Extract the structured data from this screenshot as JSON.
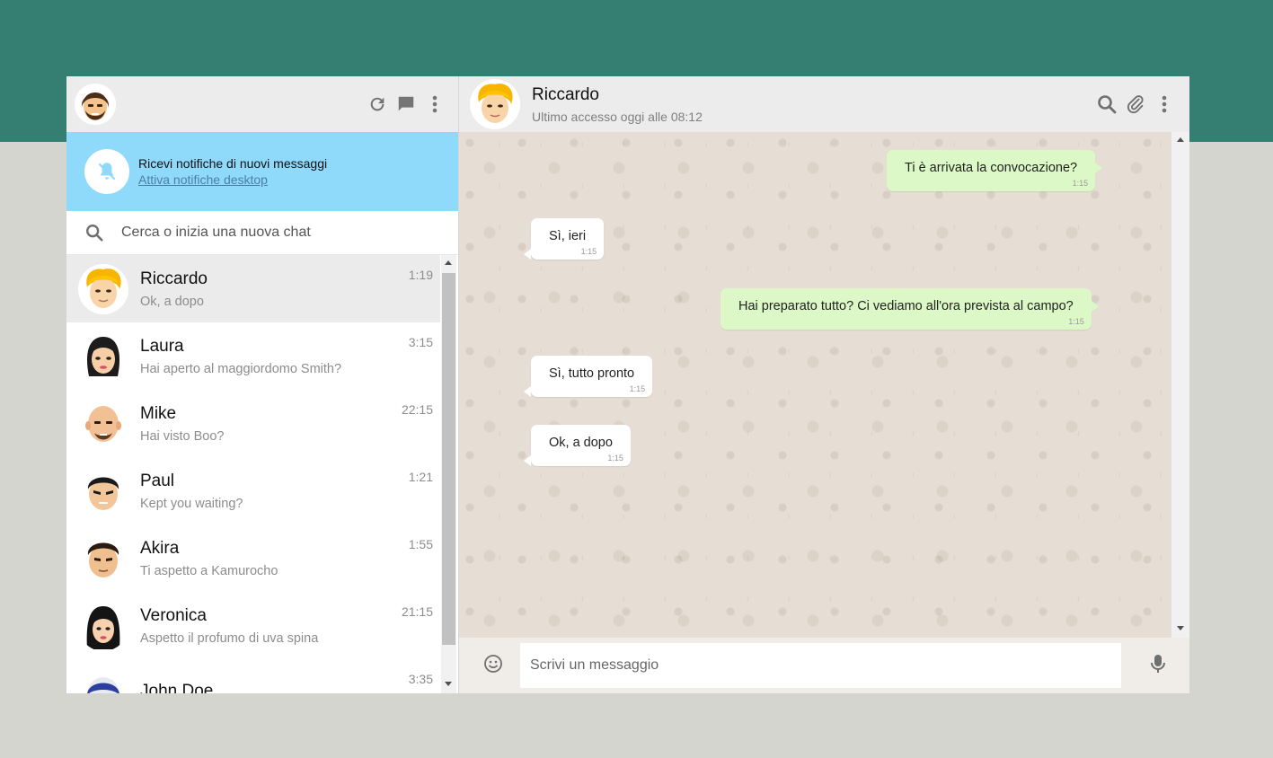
{
  "notification": {
    "title": "Ricevi notifiche di nuovi messaggi",
    "link": "Attiva notifiche desktop"
  },
  "search": {
    "placeholder": "Cerca o inizia una nuova chat"
  },
  "chats": [
    {
      "name": "Riccardo",
      "preview": "Ok, a dopo",
      "time": "1:19",
      "active": true
    },
    {
      "name": "Laura",
      "preview": "Hai aperto al maggiordomo Smith?",
      "time": "3:15"
    },
    {
      "name": "Mike",
      "preview": "Hai visto Boo?",
      "time": "22:15"
    },
    {
      "name": "Paul",
      "preview": "Kept you waiting?",
      "time": "1:21"
    },
    {
      "name": "Akira",
      "preview": "Ti aspetto a Kamurocho",
      "time": "1:55"
    },
    {
      "name": "Veronica",
      "preview": "Aspetto il profumo di uva spina",
      "time": "21:15"
    },
    {
      "name": "John Doe",
      "preview": "",
      "time": "3:35"
    }
  ],
  "conversation": {
    "name": "Riccardo",
    "status": "Ultimo accesso oggi alle 08:12",
    "messages": [
      {
        "direction": "out",
        "text": "Ti è arrivata la convocazione?",
        "time": "1:15"
      },
      {
        "direction": "in",
        "text": "Sì, ieri",
        "time": "1:15"
      },
      {
        "direction": "out",
        "text": "Hai preparato tutto? Ci vediamo all'ora prevista al campo?",
        "time": "1:15"
      },
      {
        "direction": "in",
        "text": "Sì, tutto pronto",
        "time": "1:15"
      },
      {
        "direction": "in",
        "text": "Ok, a dopo",
        "time": "1:15"
      }
    ]
  },
  "composer": {
    "placeholder": "Scrivi un messaggio"
  },
  "colors": {
    "top_band": "#357f72",
    "notification_bg": "#8fd9fb",
    "outgoing_bubble": "#dcf8c6",
    "incoming_bubble": "#ffffff"
  }
}
